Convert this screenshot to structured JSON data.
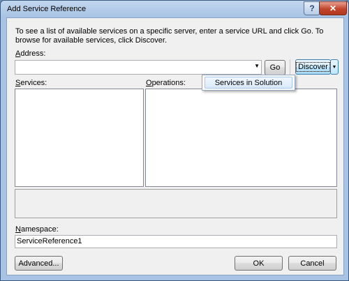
{
  "window": {
    "title": "Add Service Reference",
    "help_glyph": "?",
    "close_glyph": "✕"
  },
  "instruction": "To see a list of available services on a specific server, enter a service URL and click Go. To browse for available services, click Discover.",
  "address": {
    "label": "Address:",
    "value": "",
    "arrow_glyph": "▼"
  },
  "buttons": {
    "go": "Go",
    "discover": "Discover",
    "discover_arrow": "▼",
    "advanced": "Advanced...",
    "ok": "OK",
    "cancel": "Cancel"
  },
  "services": {
    "label": "Services:",
    "items": []
  },
  "operations": {
    "label": "Operations:",
    "items": []
  },
  "namespace": {
    "label": "Namespace:",
    "value": "ServiceReference1"
  },
  "discover_menu": {
    "items": [
      "Services in Solution"
    ]
  },
  "colors": {
    "title_bar": "#a8c3e4",
    "close_button": "#c2442a",
    "dialog_bg": "#f0f0f0",
    "menu_highlight": "#d8e9fb"
  }
}
